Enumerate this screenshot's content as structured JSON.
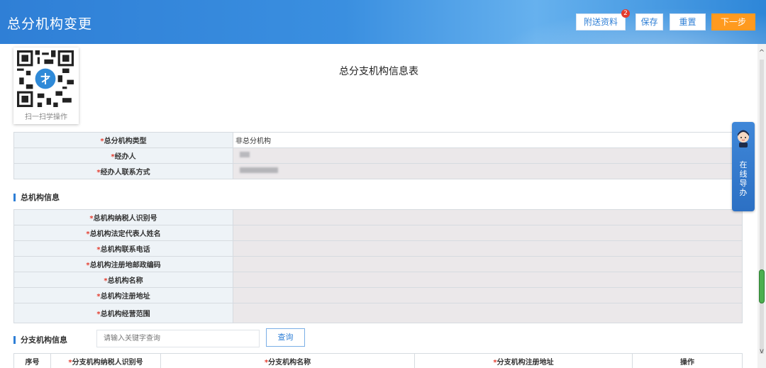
{
  "header": {
    "title": "总分机构变更",
    "buttons": {
      "attach": "附送资料",
      "attach_badge": "2",
      "save": "保存",
      "reset": "重置",
      "next": "下一步"
    }
  },
  "qr": {
    "label": "扫一扫学操作"
  },
  "page_title": "总分支机构信息表",
  "basic_form": {
    "rows": [
      {
        "label": "总分机构类型",
        "value": "非总分机构"
      },
      {
        "label": "经办人",
        "value": ""
      },
      {
        "label": "经办人联系方式",
        "value": ""
      }
    ]
  },
  "head_office": {
    "section_title": "总机构信息",
    "rows": [
      {
        "label": "总机构纳税人识别号",
        "value": ""
      },
      {
        "label": "总机构法定代表人姓名",
        "value": ""
      },
      {
        "label": "总机构联系电话",
        "value": ""
      },
      {
        "label": "总机构注册地邮政编码",
        "value": ""
      },
      {
        "label": "总机构名称",
        "value": ""
      },
      {
        "label": "总机构注册地址",
        "value": ""
      },
      {
        "label": "总机构经营范围",
        "value": ""
      }
    ]
  },
  "branch": {
    "section_title": "分支机构信息",
    "search_placeholder": "请输入关键字查询",
    "search_button": "查询",
    "columns": [
      "序号",
      "分支机构纳税人识别号",
      "分支机构名称",
      "分支机构注册地址",
      "操作"
    ]
  },
  "required_mark": "*",
  "float_guide": {
    "text": "在线导办"
  },
  "colors": {
    "primary": "#2f7fd6",
    "accent": "#ff9a1f",
    "badge": "#e43b2c"
  }
}
